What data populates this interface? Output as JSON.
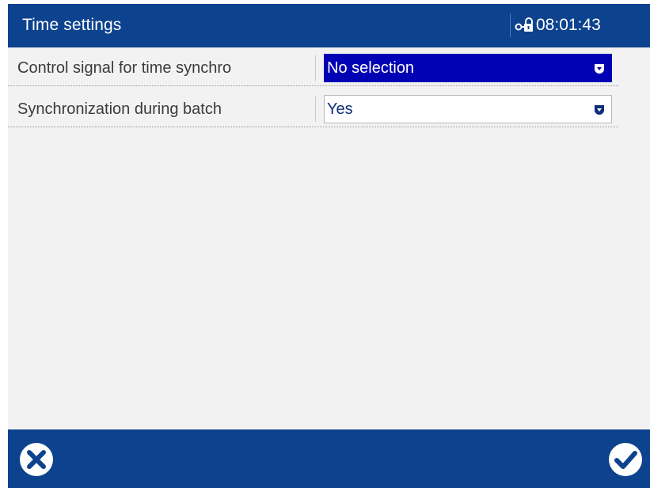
{
  "header": {
    "title": "Time settings",
    "time": "08:01:43",
    "status_icon": "lock-icon"
  },
  "settings": [
    {
      "label": "Control signal for time synchro",
      "value": "No selection",
      "focused": true
    },
    {
      "label": "Synchronization during batch",
      "value": "Yes",
      "focused": false
    }
  ],
  "footer": {
    "cancel_icon": "close-icon",
    "confirm_icon": "checkmark-icon"
  },
  "colors": {
    "header_bg": "#0d428e",
    "focus_bg": "#0000b4",
    "panel_bg": "#f2f2f2",
    "value_text": "#0d2f7a"
  }
}
